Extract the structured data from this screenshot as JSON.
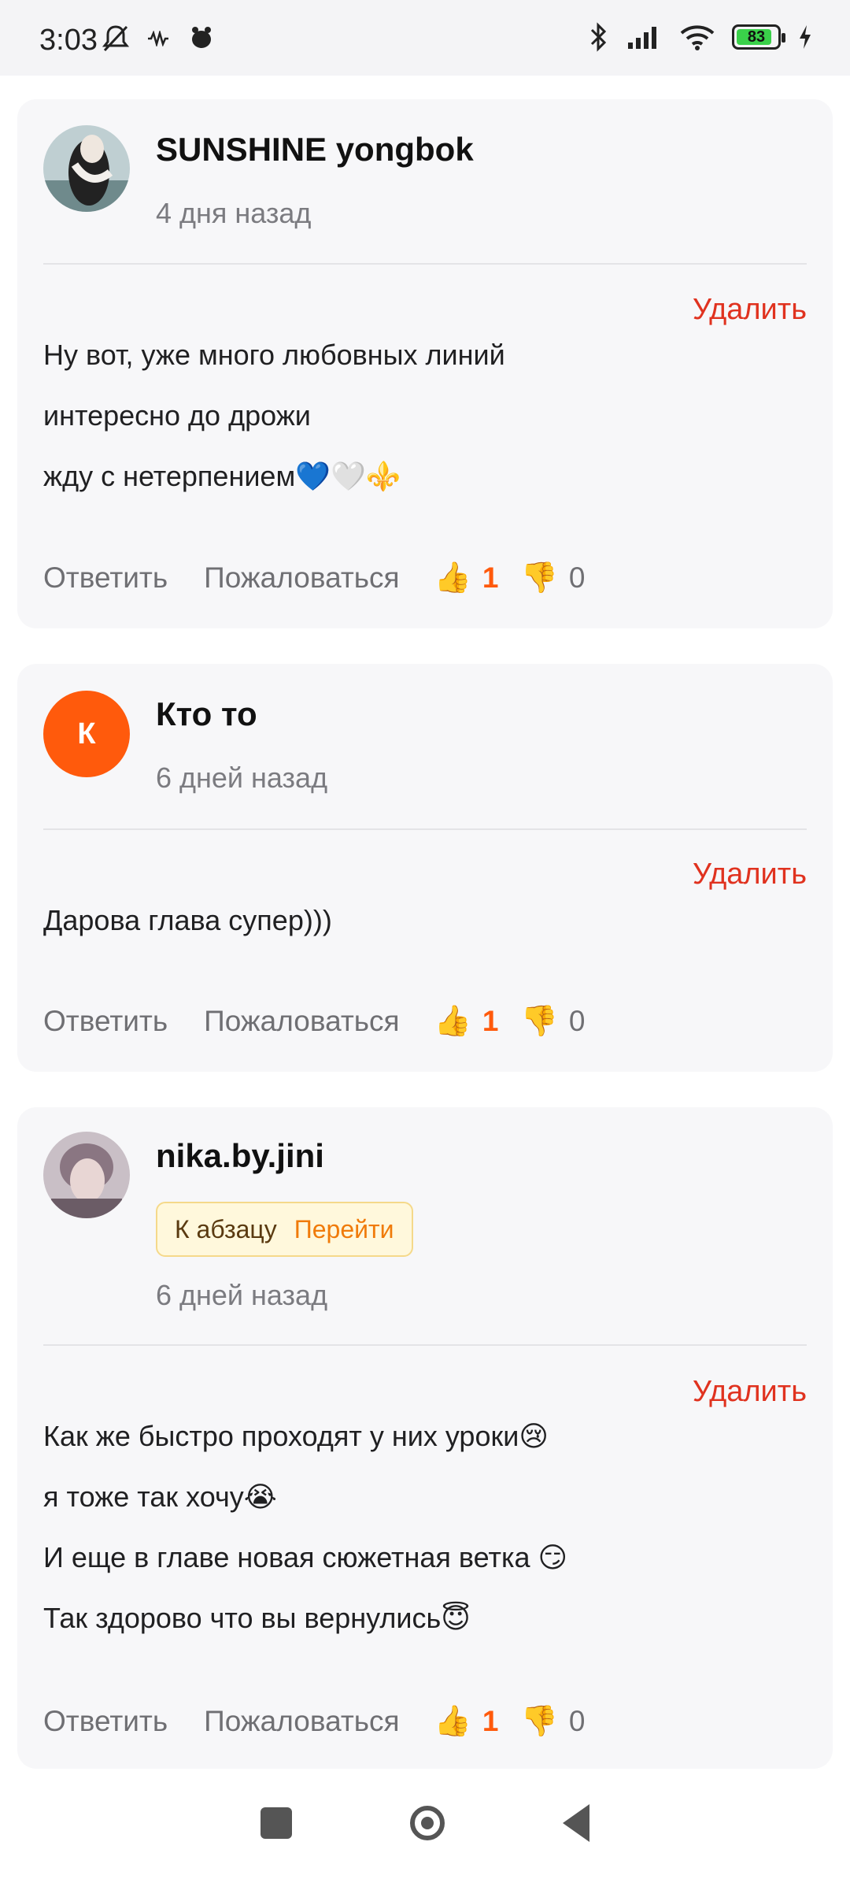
{
  "status_bar": {
    "time": "3:03",
    "battery_level": "83",
    "icons": [
      "bell-muted-icon",
      "vibrate-icon",
      "app-bug-icon",
      "bluetooth-icon",
      "signal-icon",
      "wifi-icon",
      "battery-icon",
      "charging-icon"
    ]
  },
  "comments": [
    {
      "username": "SUNSHINE yongbok",
      "time": "4 дня назад",
      "delete_label": "Удалить",
      "lines": [
        "Ну вот, уже много любовных линий",
        "интересно до дрожи",
        "жду с нетерпением💙🤍⚜️"
      ],
      "reply_label": "Ответить",
      "report_label": "Пожаловаться",
      "likes": "1",
      "dislikes": "0"
    },
    {
      "username": "Кто то",
      "avatar_letter": "К",
      "time": "6 дней назад",
      "delete_label": "Удалить",
      "lines": [
        "Дарова глава супер)))"
      ],
      "reply_label": "Ответить",
      "report_label": "Пожаловаться",
      "likes": "1",
      "dislikes": "0"
    },
    {
      "username": "nika.by.jini",
      "paragraph_label": "К абзацу",
      "goto_label": "Перейти",
      "time": "6 дней назад",
      "delete_label": "Удалить",
      "lines": [
        "Как же быстро проходят у них уроки😢",
        "я тоже так хочу😭",
        "И еще в главе новая сюжетная ветка 😏",
        "Так здорово что вы вернулись😇"
      ],
      "reply_label": "Ответить",
      "report_label": "Пожаловаться",
      "likes": "1",
      "dislikes": "0"
    }
  ],
  "icons": {
    "like": "👍",
    "dislike": "👎"
  },
  "colors": {
    "accent": "#ff5a0c",
    "delete": "#e0321f",
    "card_bg": "#f7f7f9"
  }
}
